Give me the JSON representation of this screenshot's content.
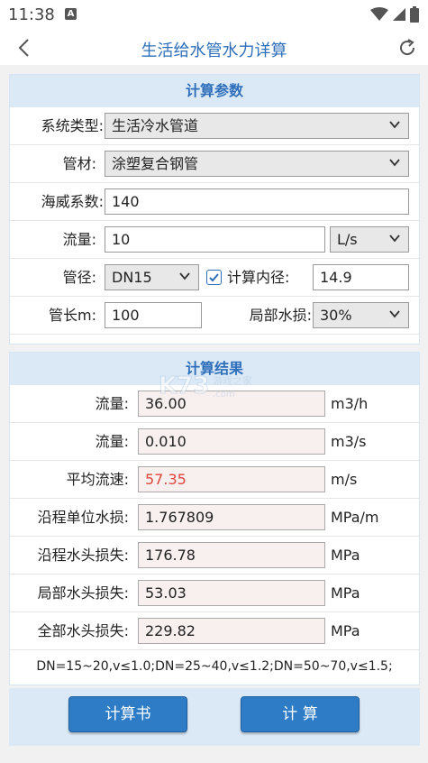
{
  "status": {
    "time": "11:38",
    "notif_glyph": "A"
  },
  "header": {
    "title": "生活给水管水力详算"
  },
  "params": {
    "heading": "计算参数",
    "system_type": {
      "label": "系统类型:",
      "value": "生活冷水管道"
    },
    "material": {
      "label": "管材:",
      "value": "涂塑复合钢管"
    },
    "hazen": {
      "label": "海威系数:",
      "value": "140"
    },
    "flow": {
      "label": "流量:",
      "value": "10",
      "unit": "L/s"
    },
    "diameter": {
      "label": "管径:",
      "value": "DN15",
      "check_label": "计算内径:",
      "inner_value": "14.9",
      "checked": true
    },
    "length": {
      "label": "管长m:",
      "value": "100",
      "local_loss_label": "局部水损:",
      "local_loss_value": "30%"
    }
  },
  "results": {
    "heading": "计算结果",
    "rows": [
      {
        "label": "流量:",
        "value": "36.00",
        "unit": "m3/h"
      },
      {
        "label": "流量:",
        "value": "0.010",
        "unit": "m3/s"
      },
      {
        "label": "平均流速:",
        "value": "57.35",
        "unit": "m/s"
      },
      {
        "label": "沿程单位水损:",
        "value": "1.767809",
        "unit": "MPa/m"
      },
      {
        "label": "沿程水头损失:",
        "value": "176.78",
        "unit": "MPa"
      },
      {
        "label": "局部水头损失:",
        "value": "53.03",
        "unit": "MPa"
      },
      {
        "label": "全部水头损失:",
        "value": "229.82",
        "unit": "MPa"
      }
    ],
    "note": "DN=15~20,v≤1.0;DN=25~40,v≤1.2;DN=50~70,v≤1.5;"
  },
  "buttons": {
    "report": "计算书",
    "calculate": "计 算"
  },
  "colors": {
    "accent": "#2f6fba",
    "section_bg": "#dbe9f7",
    "button": "#2f7cc6",
    "warning_text": "#e0453c"
  }
}
